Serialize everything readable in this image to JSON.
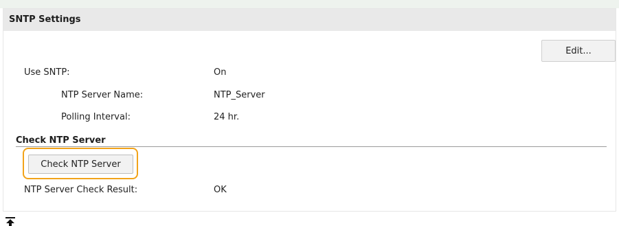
{
  "section": {
    "title": "SNTP Settings",
    "edit_label": "Edit..."
  },
  "settings": [
    {
      "label": "Use SNTP:",
      "value": "On"
    },
    {
      "label": "NTP Server Name:",
      "value": "NTP_Server"
    },
    {
      "label": "Polling Interval:",
      "value": "24 hr."
    }
  ],
  "check": {
    "title": "Check NTP Server",
    "button_label": "Check NTP Server",
    "highlight_color": "#f2a319",
    "result_label": "NTP Server Check Result:",
    "result_value": "OK"
  },
  "icons": {
    "scroll_top": "back-to-top-icon"
  }
}
